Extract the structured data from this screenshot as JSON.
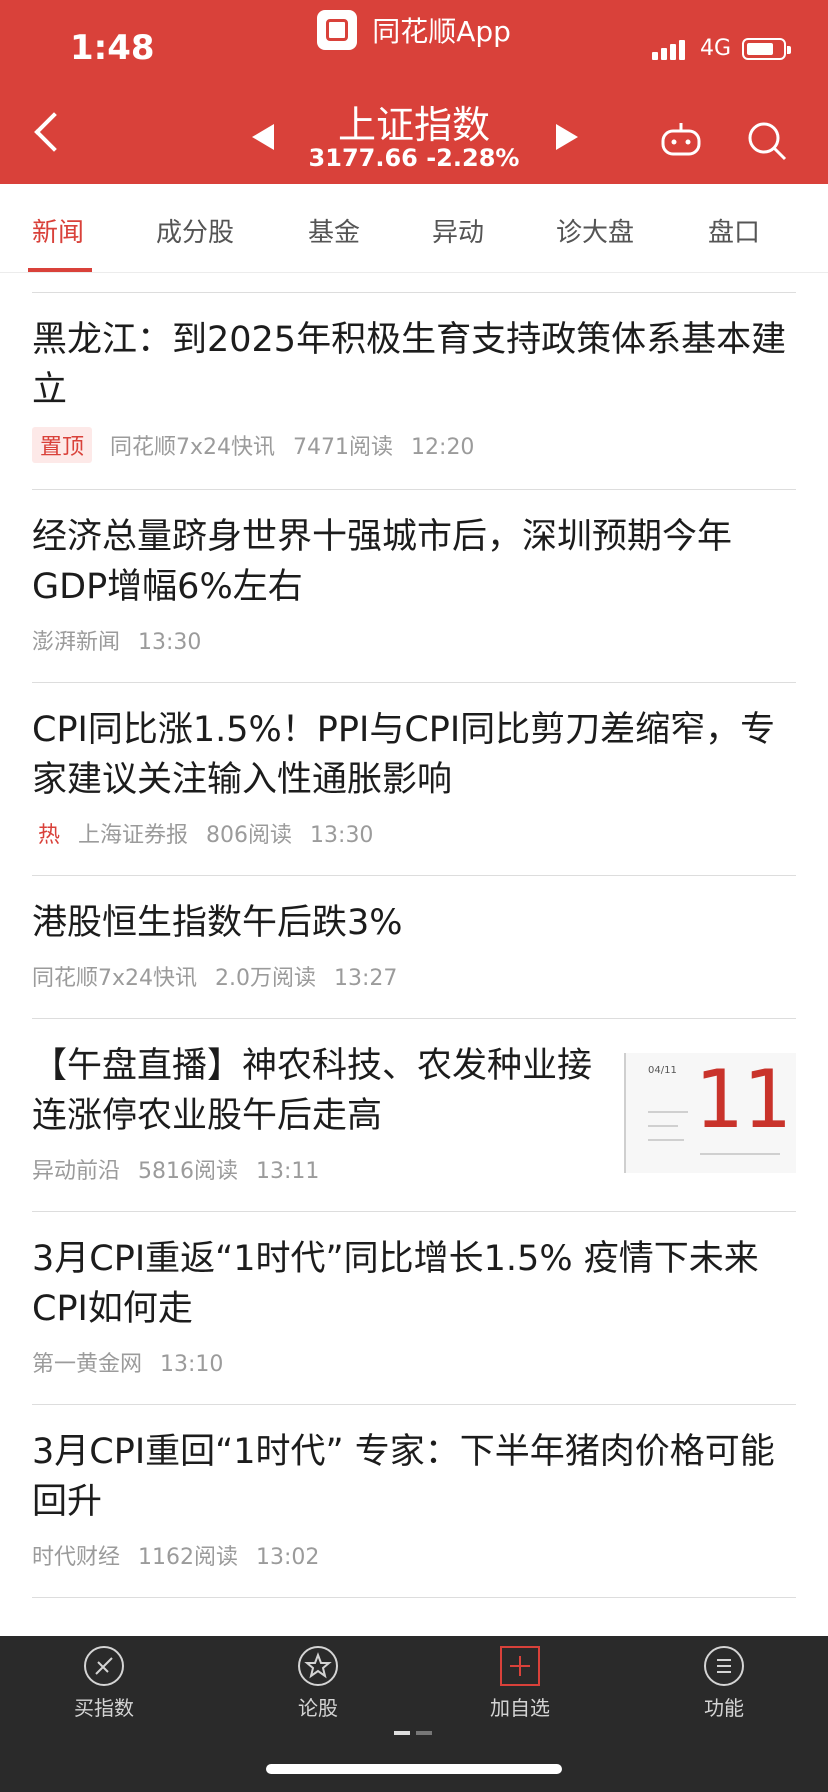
{
  "status_bar": {
    "time": "1:48",
    "network": "4G"
  },
  "header": {
    "app_name": "同花顺App",
    "index_name": "上证指数",
    "index_quote": "3177.66 -2.28%"
  },
  "tabs": [
    {
      "label": "新闻"
    },
    {
      "label": "成分股"
    },
    {
      "label": "基金"
    },
    {
      "label": "异动"
    },
    {
      "label": "诊大盘"
    },
    {
      "label": "盘口"
    }
  ],
  "news": [
    {
      "title": "黑龙江：到2025年积极生育支持政策体系基本建立",
      "tag": "置顶",
      "source": "同花顺7x24快讯",
      "reads": "7471阅读",
      "time": "12:20"
    },
    {
      "title": "经济总量跻身世界十强城市后，深圳预期今年GDP增幅6%左右",
      "source": "澎湃新闻",
      "time": "13:30"
    },
    {
      "title": "CPI同比涨1.5%！PPI与CPI同比剪刀差缩窄，专家建议关注输入性通胀影响",
      "tag": "热",
      "source": "上海证券报",
      "reads": "806阅读",
      "time": "13:30"
    },
    {
      "title": "港股恒生指数午后跌3%",
      "source": "同花顺7x24快讯",
      "reads": "2.0万阅读",
      "time": "13:27"
    },
    {
      "title": "【午盘直播】神农科技、农发种业接连涨停农业股午后走高",
      "source": "异动前沿",
      "reads": "5816阅读",
      "time": "13:11",
      "thumb": {
        "date": "04/11",
        "day": "11"
      }
    },
    {
      "title": "3月CPI重返“1时代”同比增长1.5% 疫情下未来CPI如何走",
      "source": "第一黄金网",
      "time": "13:10"
    },
    {
      "title": "3月CPI重回“1时代” 专家：下半年猪肉价格可能回升",
      "source": "时代财经",
      "reads": "1162阅读",
      "time": "13:02"
    }
  ],
  "bottom_nav": [
    {
      "label": "买指数",
      "icon": "buy-index-icon"
    },
    {
      "label": "论股",
      "icon": "discuss-icon"
    },
    {
      "label": "加自选",
      "icon": "add-watchlist-icon"
    },
    {
      "label": "功能",
      "icon": "menu-icon"
    }
  ],
  "colors": {
    "brand": "#d9413a"
  }
}
